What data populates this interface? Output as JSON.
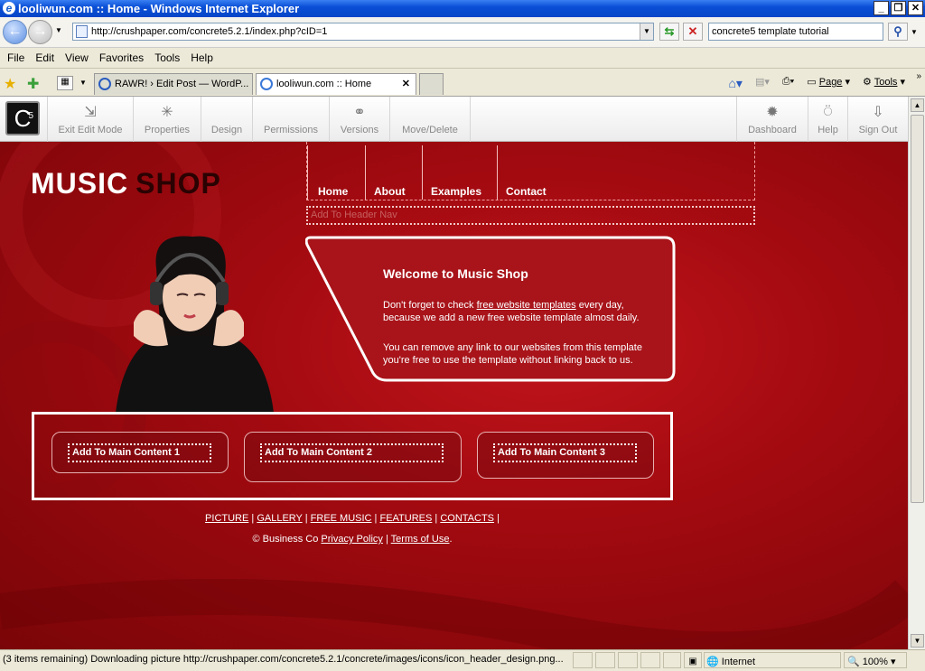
{
  "window": {
    "title": "looliwun.com :: Home - Windows Internet Explorer"
  },
  "address": {
    "url": "http://crushpaper.com/concrete5.2.1/index.php?cID=1",
    "search_value": "concrete5 template tutorial"
  },
  "menu": [
    "File",
    "Edit",
    "View",
    "Favorites",
    "Tools",
    "Help"
  ],
  "tabs": [
    {
      "label": "RAWR! › Edit Post — WordP..."
    },
    {
      "label": "looliwun.com :: Home"
    }
  ],
  "ie_tools": {
    "page": "Page",
    "tools": "Tools"
  },
  "c5toolbar": {
    "left": [
      "Exit Edit Mode",
      "Properties",
      "Design",
      "Permissions",
      "Versions",
      "Move/Delete"
    ],
    "right": [
      "Dashboard",
      "Help",
      "Sign Out"
    ],
    "logo": "C"
  },
  "site": {
    "logo_music": "MUSIC",
    "logo_shop": "SHOP",
    "nav": [
      "Home",
      "About",
      "Examples",
      "Contact"
    ],
    "add_header_nav": "Add To Header Nav",
    "welcome_title": "Welcome to Music Shop",
    "welcome_p1_before": "Don't forget to check ",
    "welcome_p1_link": "free website templates",
    "welcome_p1_after": " every day, because we add a new  free website template almost daily.",
    "welcome_p2": "You can remove any link to our websites from this template you're free to use the template without linking back to us.",
    "main_content": [
      "Add To Main Content 1",
      "Add To Main Content 2",
      "Add To Main Content 3"
    ],
    "footer_links": [
      "PICTURE",
      "GALLERY",
      "FREE MUSIC",
      "FEATURES",
      "CONTACTS"
    ],
    "copyright_prefix": "© Business Co ",
    "privacy": "Privacy Policy",
    "terms": "Terms of Use"
  },
  "status": {
    "message": "(3 items remaining) Downloading picture http://crushpaper.com/concrete5.2.1/concrete/images/icons/icon_header_design.png...",
    "zone": "Internet",
    "zoom": "100%"
  },
  "colors": {
    "page_red": "#a20a10",
    "c5_text": "#888888"
  }
}
